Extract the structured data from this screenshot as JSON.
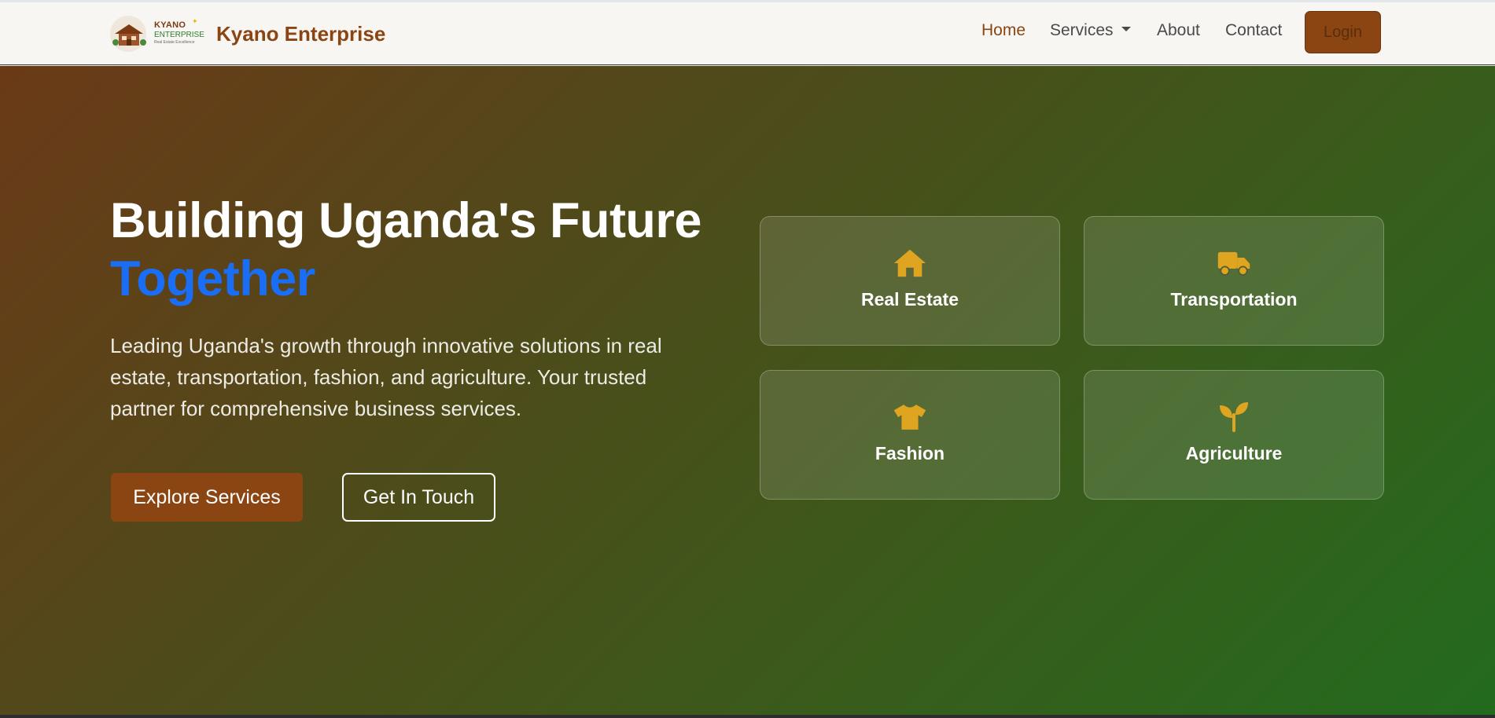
{
  "brand": {
    "name": "Kyano Enterprise",
    "logo_line1": "KYANO",
    "logo_line2": "ENTERPRISE",
    "logo_line3": "Real Estate Excellence"
  },
  "nav": {
    "items": [
      {
        "label": "Home",
        "active": true
      },
      {
        "label": "Services",
        "dropdown": true
      },
      {
        "label": "About"
      },
      {
        "label": "Contact"
      }
    ],
    "login_label": "Login"
  },
  "hero": {
    "title_line1": "Building Uganda's Future",
    "title_line2": "Together",
    "description": "Leading Uganda's growth through innovative solutions in real estate, transportation, fashion, and agriculture. Your trusted partner for comprehensive business services.",
    "primary_button": "Explore Services",
    "secondary_button": "Get In Touch"
  },
  "services": [
    {
      "label": "Real Estate",
      "icon": "house-icon"
    },
    {
      "label": "Transportation",
      "icon": "truck-icon"
    },
    {
      "label": "Fashion",
      "icon": "shirt-icon"
    },
    {
      "label": "Agriculture",
      "icon": "seedling-icon"
    }
  ],
  "colors": {
    "brand": "#8b4513",
    "accent_blue": "#1a6ef5",
    "icon_gold": "#e0a520",
    "gradient_start": "#6b3a17",
    "gradient_end": "#236b1e"
  }
}
